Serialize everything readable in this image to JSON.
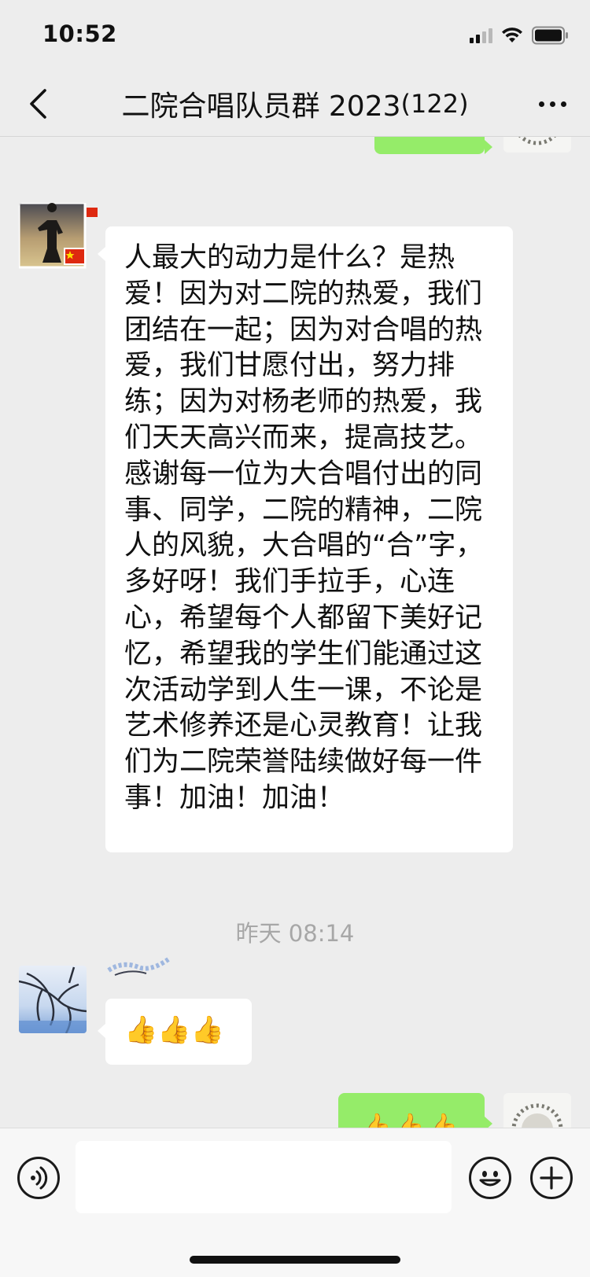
{
  "status_bar": {
    "time": "10:52"
  },
  "nav": {
    "title": "二院合唱队员群 2023",
    "member_count": "(122)"
  },
  "messages": {
    "top_sent_emoji": "🙏👌",
    "long_text": "人最大的动力是什么？是热爱！因为对二院的热爱，我们团结在一起；因为对合唱的热爱，我们甘愿付出，努力排练；因为对杨老师的热爱，我们天天高兴而来，提高技艺。感谢每一位为大合唱付出的同事、同学，二院的精神，二院人的风貌，大合唱的“合”字，多好呀！我们手拉手，心连心，希望每个人都留下美好记忆，希望我的学生们能通过这次活动学到人生一课，不论是艺术修养还是心灵教育！让我们为二院荣誉陆续做好每一件事！加油！加油！",
    "timestamp": "昨天 08:14",
    "thumbs_emoji": "👍👍👍",
    "bottom_sent_emoji": "👍👍👍"
  },
  "colors": {
    "background": "#ededed",
    "sent_bubble": "#95ec69",
    "received_bubble": "#ffffff",
    "timestamp_text": "#a7a7a7"
  },
  "icons": {
    "back": "chevron-left-icon",
    "more": "more-dots-icon",
    "voice": "voice-icon",
    "emoji": "emoji-face-icon",
    "plus": "plus-icon"
  }
}
